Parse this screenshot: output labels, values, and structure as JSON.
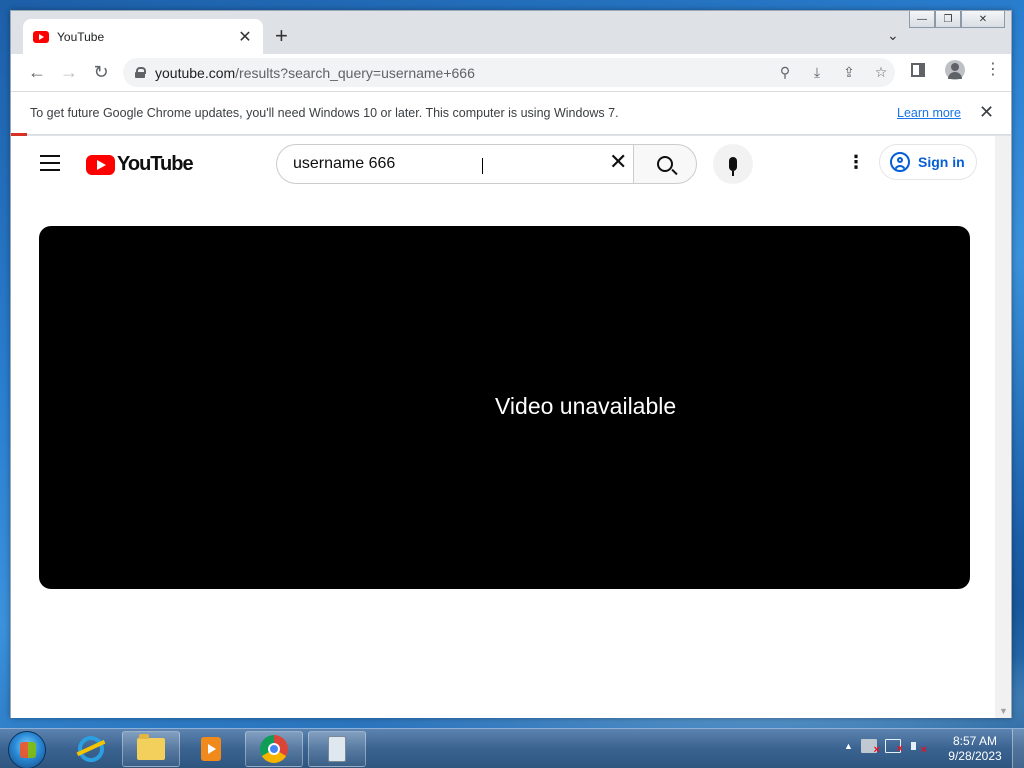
{
  "browser": {
    "tab": {
      "title": "YouTube",
      "close": "✕",
      "favicon": "youtube-favicon"
    },
    "new_tab": "+",
    "tab_search": "⌄",
    "window_controls": {
      "minimize": "—",
      "maximize": "❐",
      "close": "✕"
    },
    "nav": {
      "back": "←",
      "forward": "→",
      "reload": "↻"
    },
    "address": {
      "host": "youtube.com",
      "path": "/results?search_query=username+666"
    },
    "omnibox_icons": [
      "search-icon",
      "install-icon",
      "share-icon",
      "star-icon"
    ],
    "omnibox_glyphs": {
      "zoom": "⚲",
      "install": "⤓",
      "share": "⇪",
      "bookmark": "☆"
    },
    "menu": "⋮"
  },
  "infobar": {
    "message": "To get future Google Chrome updates, you'll need Windows 10 or later. This computer is using Windows 7.",
    "link": "Learn more",
    "close": "✕"
  },
  "youtube": {
    "logo_text": "YouTube",
    "search": {
      "value": "username 666",
      "clear": "✕"
    },
    "more": "⋮",
    "signin_label": "Sign in",
    "player_message": "Video unavailable"
  },
  "taskbar": {
    "apps": [
      "internet-explorer",
      "windows-explorer",
      "windows-media-player",
      "google-chrome",
      "device-manager"
    ],
    "tray_arrow": "▲",
    "clock": {
      "time": "8:57 AM",
      "date": "9/28/2023"
    }
  },
  "colors": {
    "youtube_red": "#ff0000",
    "link_blue": "#1a73e8",
    "signin_blue": "#065fd4",
    "player_bg": "#000000"
  }
}
